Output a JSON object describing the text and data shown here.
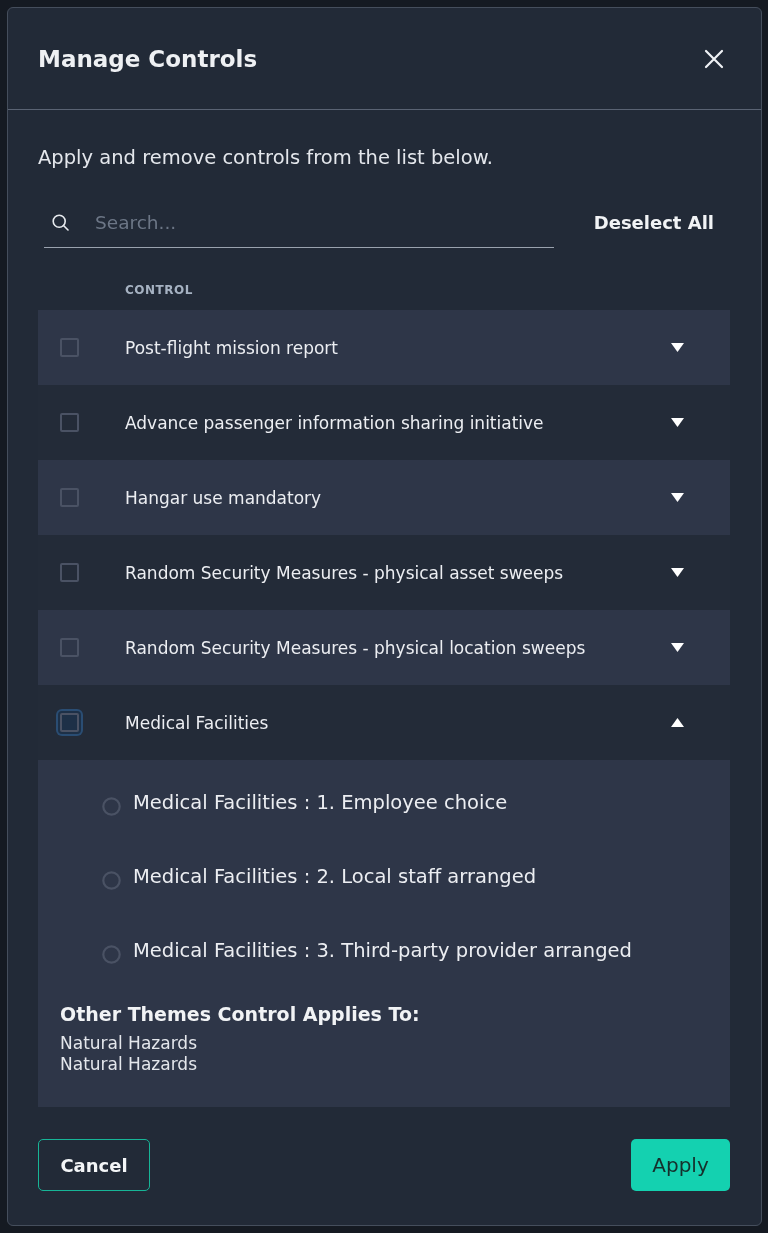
{
  "dialog": {
    "title": "Manage Controls"
  },
  "description": "Apply and remove controls from the list below.",
  "search": {
    "placeholder": "Search..."
  },
  "deselect_all": "Deselect All",
  "table": {
    "column_header": "CONTROL",
    "rows": [
      {
        "label": "Post-flight mission report",
        "checked": false,
        "focused": false,
        "expanded": false
      },
      {
        "label": "Advance passenger information sharing initiative",
        "checked": false,
        "focused": false,
        "expanded": false
      },
      {
        "label": "Hangar use mandatory",
        "checked": false,
        "focused": false,
        "expanded": false
      },
      {
        "label": "Random Security Measures - physical asset sweeps",
        "checked": false,
        "focused": false,
        "expanded": false
      },
      {
        "label": "Random Security Measures - physical location sweeps",
        "checked": false,
        "focused": false,
        "expanded": false
      },
      {
        "label": "Medical Facilities",
        "checked": false,
        "focused": true,
        "expanded": true,
        "options": [
          {
            "label": "Medical Facilities : 1. Employee choice",
            "selected": false
          },
          {
            "label": "Medical Facilities : 2. Local staff arranged",
            "selected": false
          },
          {
            "label": "Medical Facilities : 3. Third-party provider arranged",
            "selected": false
          }
        ],
        "other_themes": {
          "heading": "Other Themes Control Applies To:",
          "items": [
            "Natural Hazards",
            "Natural Hazards"
          ]
        }
      }
    ]
  },
  "buttons": [
    {
      "label": "Cancel",
      "kind": "secondary"
    },
    {
      "label": "Apply",
      "kind": "primary"
    }
  ]
}
